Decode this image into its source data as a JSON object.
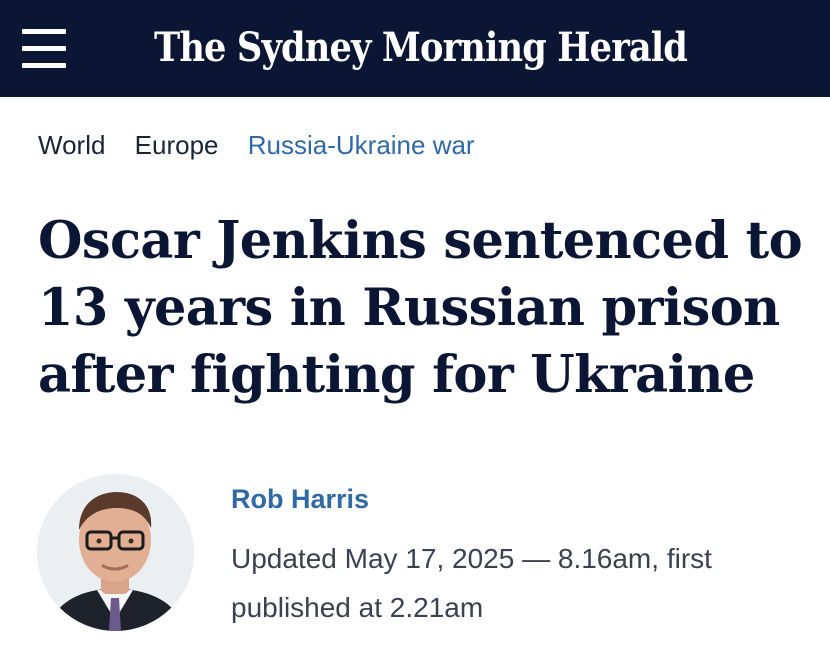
{
  "header": {
    "masthead": "The Sydney Morning Herald",
    "menu_icon": "hamburger-menu-icon",
    "background_color": "#0a1633"
  },
  "breadcrumbs": [
    {
      "label": "World"
    },
    {
      "label": "Europe"
    },
    {
      "label": "Russia-Ukraine war",
      "active": true
    }
  ],
  "article": {
    "headline": "Oscar Jenkins sentenced to 13 years in Russian prison after fighting for Ukraine",
    "author": "Rob Harris",
    "timestamp": "Updated May 17, 2025 — 8.16am, first published at 2.21am",
    "accent_color": "#2f6aa6"
  }
}
